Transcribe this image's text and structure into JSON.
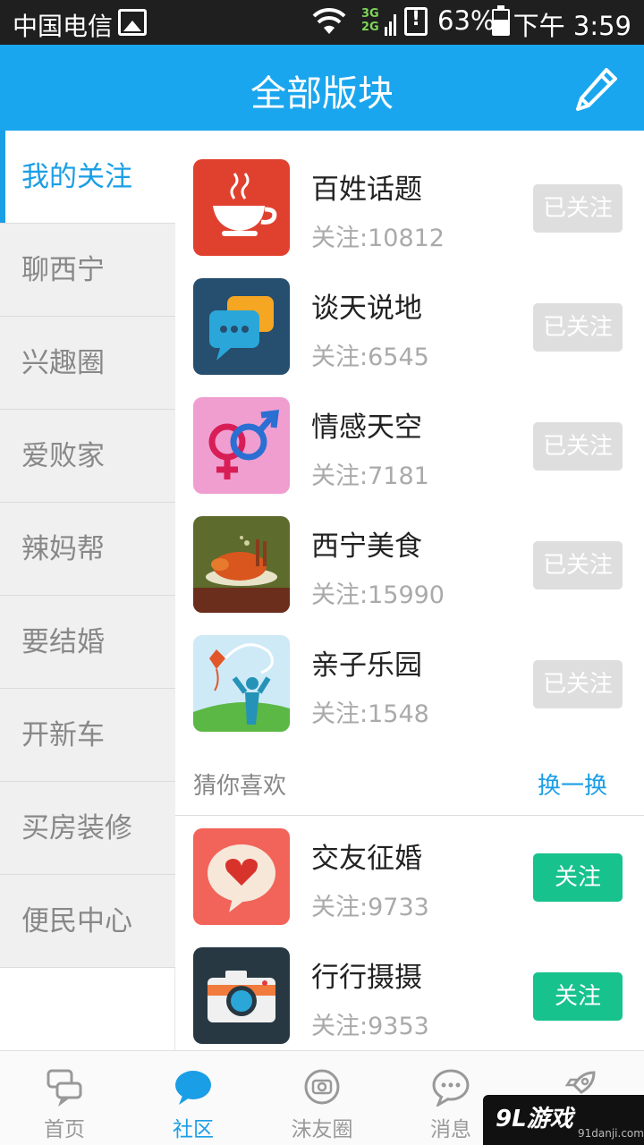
{
  "status": {
    "carrier": "中国电信",
    "net_3g": "3G",
    "net_2g": "2G",
    "battery_pct": "63%",
    "time": "下午 3:59"
  },
  "header": {
    "title": "全部版块",
    "edit_icon": "pencil-icon"
  },
  "sidebar": {
    "items": [
      {
        "label": "我的关注"
      },
      {
        "label": "聊西宁"
      },
      {
        "label": "兴趣圈"
      },
      {
        "label": "爱败家"
      },
      {
        "label": "辣妈帮"
      },
      {
        "label": "要结婚"
      },
      {
        "label": "开新车"
      },
      {
        "label": "买房装修"
      },
      {
        "label": "便民中心"
      }
    ]
  },
  "forums": [
    {
      "name": "百姓话题",
      "count": "关注:10812",
      "button": "已关注",
      "icon": "teacup-icon"
    },
    {
      "name": "谈天说地",
      "count": "关注:6545",
      "button": "已关注",
      "icon": "chat-bubbles-icon"
    },
    {
      "name": "情感天空",
      "count": "关注:7181",
      "button": "已关注",
      "icon": "gender-symbols-icon"
    },
    {
      "name": "西宁美食",
      "count": "关注:15990",
      "button": "已关注",
      "icon": "roast-chicken-icon"
    },
    {
      "name": "亲子乐园",
      "count": "关注:1548",
      "button": "已关注",
      "icon": "kite-child-icon"
    }
  ],
  "guess": {
    "label": "猜你喜欢",
    "swap": "换一换"
  },
  "recommended": [
    {
      "name": "交友征婚",
      "count": "关注:9733",
      "button": "关注",
      "icon": "heart-bubble-icon"
    },
    {
      "name": "行行摄摄",
      "count": "关注:9353",
      "button": "关注",
      "icon": "camera-icon"
    }
  ],
  "tabs": [
    {
      "label": "首页",
      "icon": "home-chat-icon"
    },
    {
      "label": "社区",
      "icon": "community-bubble-icon"
    },
    {
      "label": "沫友圈",
      "icon": "camera-circle-icon"
    },
    {
      "label": "消息",
      "icon": "message-icon"
    },
    {
      "label": "",
      "icon": "rocket-icon"
    }
  ],
  "watermark": {
    "logo": "9L游戏",
    "site": "91danji.com"
  },
  "colors": {
    "accent": "#1aa6ee",
    "follow": "#17c28d",
    "followed": "#dedede"
  }
}
